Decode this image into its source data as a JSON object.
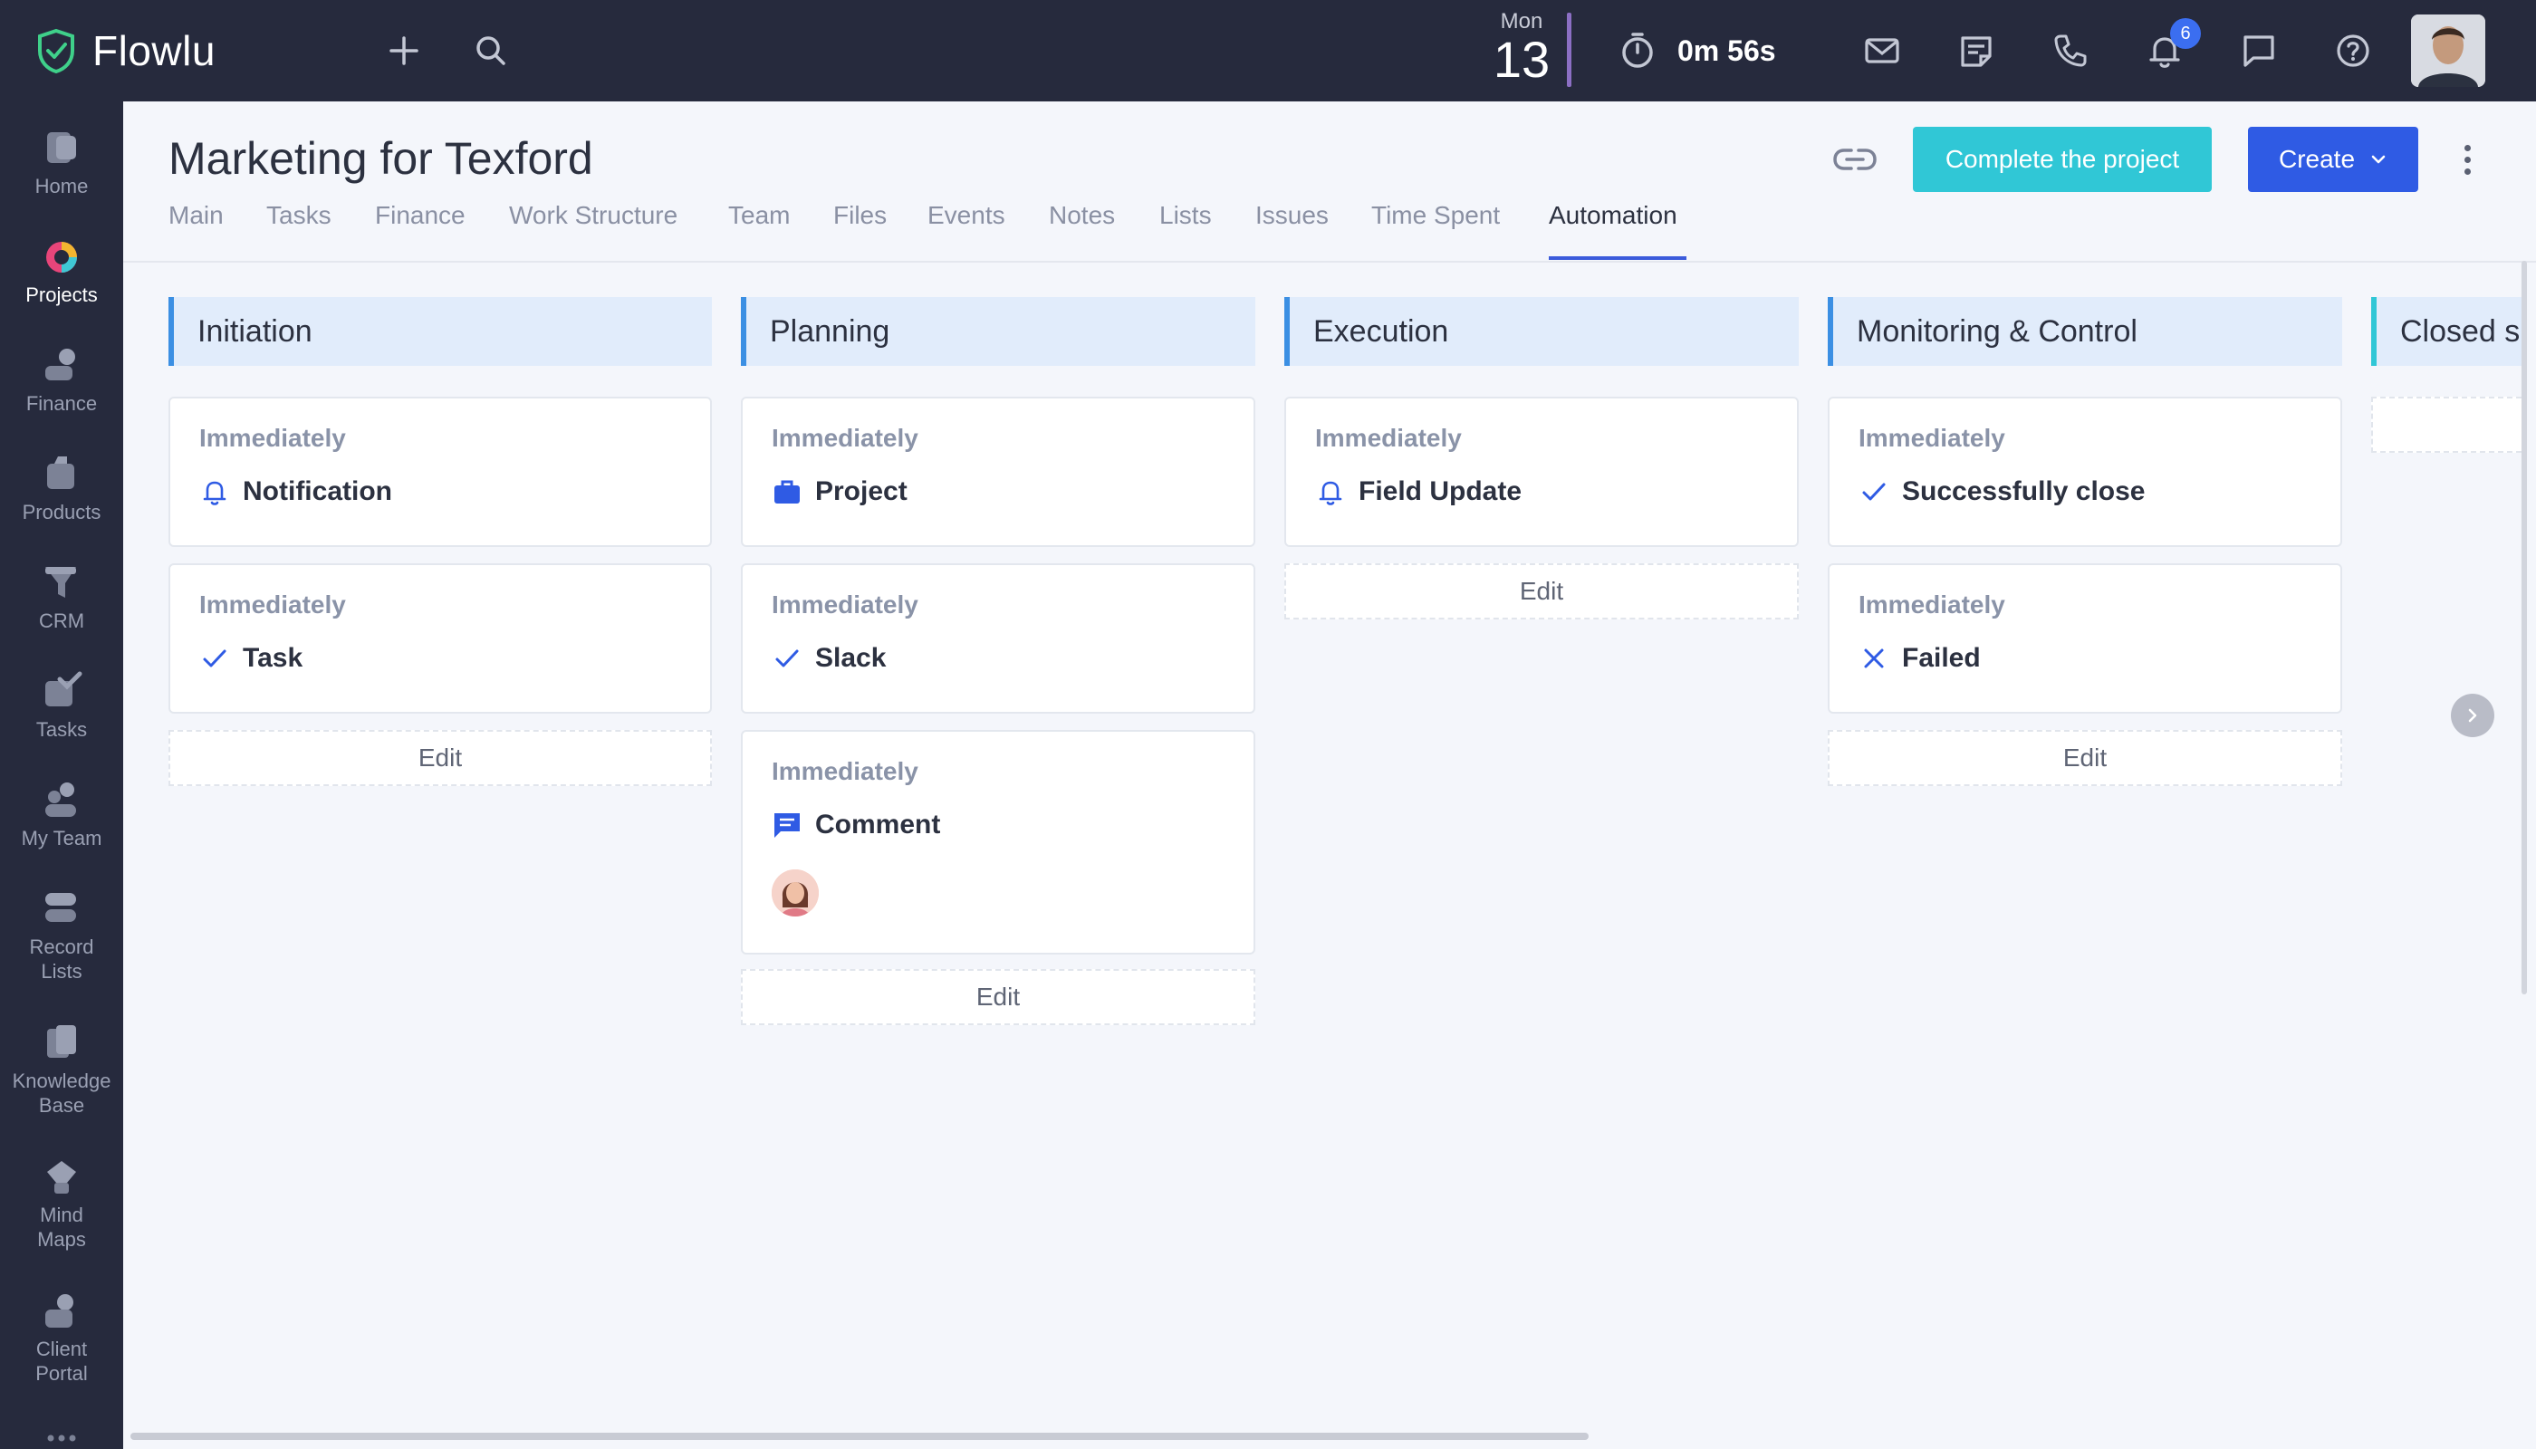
{
  "app": {
    "name": "Flowlu"
  },
  "topbar": {
    "date": {
      "dow": "Mon",
      "day": "13"
    },
    "timer": "0m 56s",
    "notifications_count": "6",
    "icons": [
      "plus-icon",
      "search-icon",
      "mail-icon",
      "notes-icon",
      "phone-icon",
      "bell-icon",
      "chat-icon",
      "help-icon"
    ]
  },
  "sidebar": {
    "items": [
      {
        "label": "Home",
        "icon": "home-icon"
      },
      {
        "label": "Projects",
        "icon": "projects-icon",
        "active": true
      },
      {
        "label": "Finance",
        "icon": "finance-icon"
      },
      {
        "label": "Products",
        "icon": "products-icon"
      },
      {
        "label": "CRM",
        "icon": "crm-icon"
      },
      {
        "label": "Tasks",
        "icon": "tasks-icon"
      },
      {
        "label": "My Team",
        "icon": "team-icon"
      },
      {
        "label": "Record Lists",
        "icon": "record-lists-icon"
      },
      {
        "label": "Knowledge Base",
        "icon": "knowledge-base-icon"
      },
      {
        "label": "Mind Maps",
        "icon": "mind-maps-icon"
      },
      {
        "label": "Client Portal",
        "icon": "client-portal-icon"
      }
    ]
  },
  "page": {
    "title": "Marketing for Texford",
    "tabs": [
      "Main",
      "Tasks",
      "Finance",
      "Work Structure",
      "Team",
      "Files",
      "Events",
      "Notes",
      "Lists",
      "Issues",
      "Time Spent",
      "Automation"
    ],
    "active_tab": "Automation",
    "complete_button": "Complete the project",
    "create_button": "Create"
  },
  "board": {
    "columns": [
      {
        "title": "Initiation",
        "cards": [
          {
            "when": "Immediately",
            "action": "Notification",
            "icon": "bell-icon"
          },
          {
            "when": "Immediately",
            "action": "Task",
            "icon": "check-icon"
          }
        ],
        "edit": "Edit"
      },
      {
        "title": "Planning",
        "cards": [
          {
            "when": "Immediately",
            "action": "Project",
            "icon": "briefcase-icon"
          },
          {
            "when": "Immediately",
            "action": "Slack",
            "icon": "check-icon"
          },
          {
            "when": "Immediately",
            "action": "Comment",
            "icon": "comment-icon"
          }
        ],
        "edit": "Edit"
      },
      {
        "title": "Execution",
        "cards": [
          {
            "when": "Immediately",
            "action": "Field Update",
            "icon": "bell-icon"
          }
        ],
        "edit": "Edit"
      },
      {
        "title": "Monitoring & Control",
        "cards": [
          {
            "when": "Immediately",
            "action": "Successfully close",
            "icon": "check-icon"
          },
          {
            "when": "Immediately",
            "action": "Failed",
            "icon": "x-icon"
          }
        ],
        "edit": "Edit"
      },
      {
        "title": "Closed s",
        "cards": [],
        "edit": ""
      }
    ]
  },
  "colors": {
    "topbar_bg": "#262a3d",
    "accent_blue": "#2f5be4",
    "accent_teal": "#30c7d6",
    "column_header_bg": "#e1ecfb",
    "column_border": "#3b8fe3"
  }
}
